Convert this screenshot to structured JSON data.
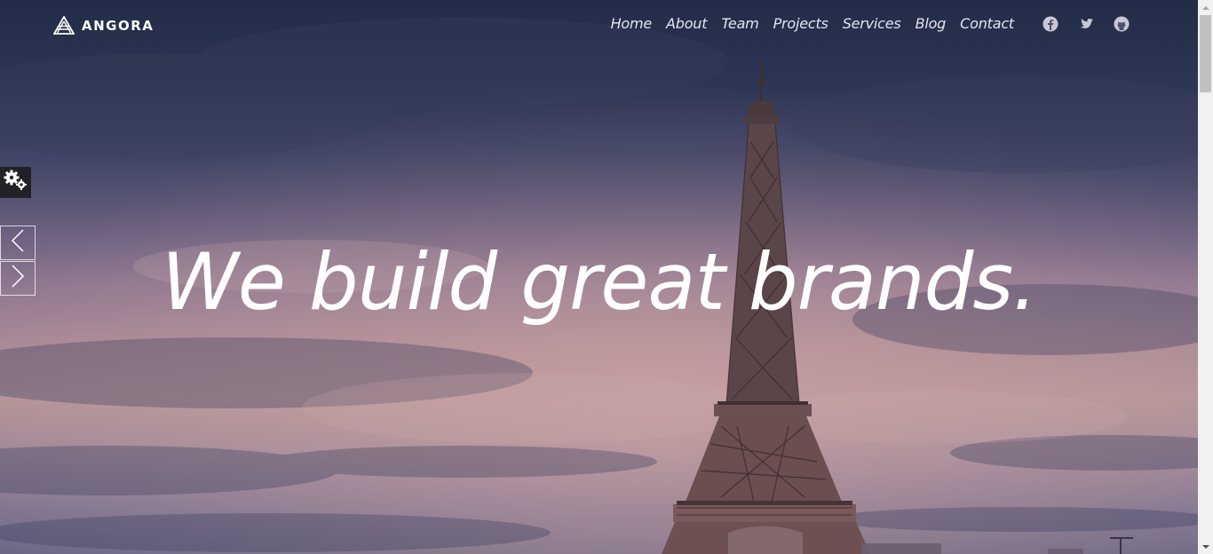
{
  "brand": {
    "name": "ANGORA",
    "logo_icon": "angora-logo-icon"
  },
  "nav": {
    "links": [
      {
        "label": "Home"
      },
      {
        "label": "About"
      },
      {
        "label": "Team"
      },
      {
        "label": "Projects"
      },
      {
        "label": "Services"
      },
      {
        "label": "Blog"
      },
      {
        "label": "Contact"
      }
    ]
  },
  "social": [
    {
      "icon": "facebook-icon"
    },
    {
      "icon": "twitter-icon"
    },
    {
      "icon": "github-icon"
    }
  ],
  "hero": {
    "headline": "We build great brands.",
    "background_image": "eiffel-tower-at-dusk"
  },
  "controls": {
    "settings_icon": "gears-icon",
    "prev_icon": "chevron-left-icon",
    "next_icon": "chevron-right-icon"
  },
  "colors": {
    "text": "#ffffff",
    "nav_text": "#e6e4ee",
    "settings_bg": "#222226"
  }
}
